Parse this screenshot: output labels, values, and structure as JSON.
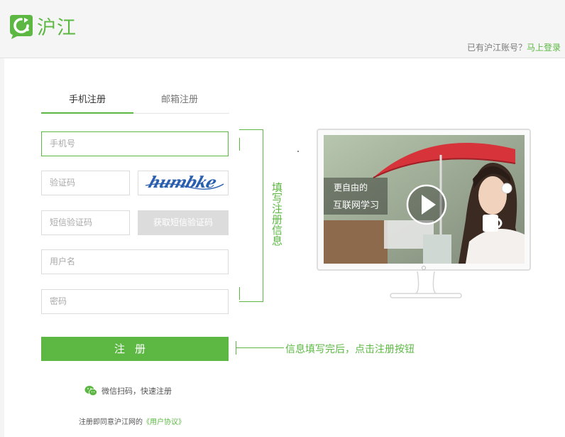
{
  "header": {
    "logo_text": "沪江",
    "login_hint": "已有沪江账号？",
    "login_link": "马上登录"
  },
  "tabs": [
    {
      "label": "手机注册",
      "active": true
    },
    {
      "label": "邮箱注册",
      "active": false
    }
  ],
  "form": {
    "phone_placeholder": "手机号",
    "code_placeholder": "验证码",
    "captcha_text": "humbke",
    "sms_placeholder": "短信验证码",
    "sms_button": "获取短信验证码",
    "username_placeholder": "用户名",
    "password_placeholder": "密码",
    "submit_label": "注册"
  },
  "wechat_label": "微信扫码，快速注册",
  "agreement": {
    "prefix": "注册即同意沪江网的",
    "link": "《用户协议》"
  },
  "annotations": {
    "fill_info": "填写注册信息",
    "submit_hint": "信息填写完后，点击注册按钮"
  },
  "promo": {
    "line1": "更自由的",
    "line2": "互联网学习"
  },
  "colors": {
    "brand_green": "#5cb843",
    "sms_button_bg": "#dcdcdc"
  }
}
